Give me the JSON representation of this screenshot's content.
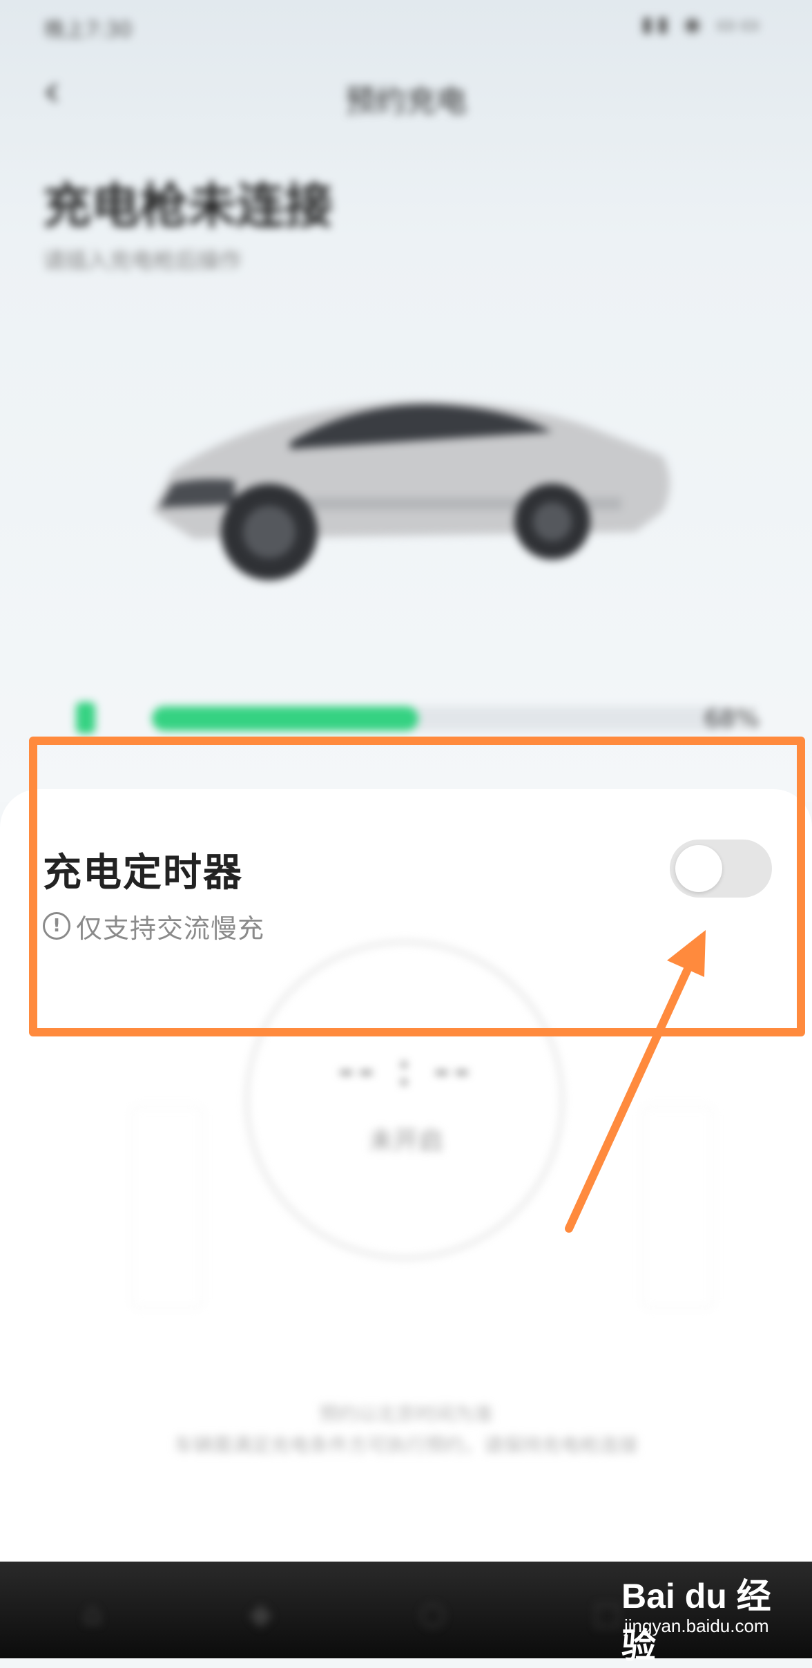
{
  "status_bar": {
    "time": "晚上7:30",
    "icons": "▮▮ ◉ ▭▭"
  },
  "header": {
    "back_icon": "chevron-left",
    "title": "预约充电"
  },
  "charging_status": {
    "title": "充电枪未连接",
    "subtitle": "请插入充电枪后操作"
  },
  "battery": {
    "level_fraction": 0.46,
    "percent_text": "68%",
    "colors": {
      "fill": "#35d282",
      "track": "#e2e6ea"
    }
  },
  "timer_card": {
    "title": "充电定时器",
    "toggle_on": false,
    "note_icon": "info-circle",
    "note_text": "仅支持交流慢充"
  },
  "timer_display": {
    "value": "-- : --",
    "state": "未开启"
  },
  "footnotes": {
    "line1": "预约以北京时间为准",
    "line2": "车辆需满足充电条件方可执行预约，请保持充电枪连接"
  },
  "bottom_nav": {
    "icons": [
      "home-icon",
      "car-icon",
      "service-icon",
      "profile-icon"
    ]
  },
  "annotation": {
    "highlight_color": "#ff8a3d"
  },
  "watermark": {
    "brand": "Bai du 经验",
    "site": "jingyan.baidu.com"
  }
}
